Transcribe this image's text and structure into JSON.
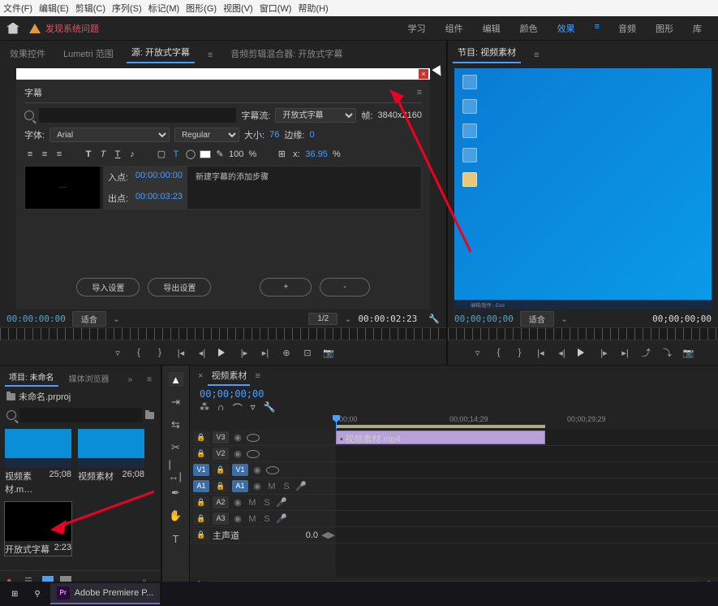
{
  "menu": {
    "file": "文件(F)",
    "edit": "编辑(E)",
    "clip": "剪辑(C)",
    "seq": "序列(S)",
    "mark": "标记(M)",
    "graph": "图形(G)",
    "view": "视图(V)",
    "win": "窗口(W)",
    "help": "帮助(H)"
  },
  "appbar": {
    "warning": "发现系统问题"
  },
  "ws": {
    "learn": "学习",
    "assembly": "组件",
    "edit": "编辑",
    "color": "颜色",
    "effects": "效果",
    "audio": "音频",
    "graphics": "图形",
    "lib": "库"
  },
  "src": {
    "tabs": {
      "fx": "效果控件",
      "lumetri": "Lumetri 范围",
      "source": "源: 开放式字幕",
      "mixer": "音频剪辑混合器: 开放式字幕"
    }
  },
  "cap": {
    "title": "字幕",
    "stream_lbl": "字幕流:",
    "stream_val": "开放式字幕",
    "frame_lbl": "帧:",
    "frame_val": "3840x2160",
    "font_lbl": "字体:",
    "font_val": "Arial",
    "style_val": "Regular",
    "size_lbl": "大小:",
    "size_val": "76",
    "edge_lbl": "边缘:",
    "edge_val": "0",
    "opacity": "100",
    "pct": "%",
    "xy": "x:",
    "xy_val": "36.95",
    "in_lbl": "入点:",
    "in_val": "00:00:00:00",
    "out_lbl": "出点:",
    "out_val": "00:00:03:23",
    "desc": "新建字幕的添加步骤",
    "import": "导入设置",
    "export": "导出设置",
    "plus": "+",
    "minus": "-"
  },
  "tc": {
    "src_l": "00:00:00:00",
    "fit": "适合",
    "half": "1/2",
    "src_r": "00:00:02:23",
    "prog_l": "00;00;00;00",
    "prog_r": "00;00;00;00"
  },
  "prog": {
    "tab": "节目: 视频素材",
    "task": "编辑/暂停 - End"
  },
  "proj": {
    "tab1": "项目: 未命名",
    "tab2": "媒体浏览器",
    "path": "未命名.prproj",
    "items": [
      {
        "name": "视频素材.m…",
        "dur": "25;08"
      },
      {
        "name": "视频素材",
        "dur": "26;08"
      },
      {
        "name": "开放式字幕",
        "dur": "2:23"
      }
    ]
  },
  "tl": {
    "tab": "视频素材",
    "tc": "00;00;00;00",
    "marks": {
      "m0": "00;00",
      "m1": "00;00;14;29",
      "m2": "00;00;29;29"
    },
    "v3": "V3",
    "v2": "V2",
    "v1": "V1",
    "a1": "A1",
    "a2": "A2",
    "a3": "A3",
    "master": "主声道",
    "mval": "0.0",
    "m": "M",
    "s": "S",
    "clip": "视频素材.mp4"
  },
  "task": {
    "app": "Adobe Premiere P..."
  }
}
